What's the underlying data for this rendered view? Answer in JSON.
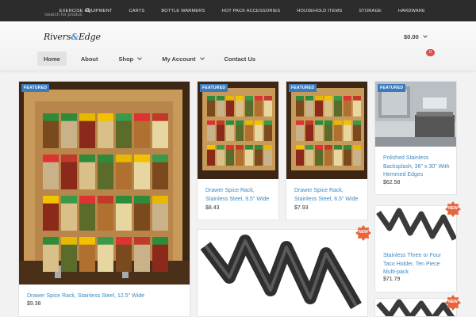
{
  "topbar": {
    "search_placeholder": "Search for product",
    "nav": [
      "EXERCISE EQUIPMENT",
      "CARTS",
      "BOTTLE WARMERS",
      "HOT PACK ACCESSORIES",
      "HOUSEHOLD ITEMS",
      "STORAGE",
      "HARDWARE"
    ]
  },
  "header": {
    "logo_left": "Rivers",
    "logo_amp": "&",
    "logo_right": "Edge",
    "nav": [
      {
        "label": "Home"
      },
      {
        "label": "About"
      },
      {
        "label": "Shop"
      },
      {
        "label": "My Account"
      },
      {
        "label": "Contact Us"
      }
    ],
    "cart_total": "$0.00",
    "cart_count": "0"
  },
  "badges": {
    "featured": "FEATURED",
    "new": "NEW"
  },
  "products": [
    {
      "title": "Drawer Spice Rack, Stainless Steel, 12.5\" Wide",
      "price": "$9.38"
    },
    {
      "title": "Drawer Spice Rack, Stainless Steel, 9.5\" Wide",
      "price": "$8.43"
    },
    {
      "title": "Drawer Spice Rack, Stainless Steel, 6.5\" Wide",
      "price": "$7.93"
    },
    {
      "title": "Polished Stainless Backsplash, 36\" x 30\" With Hemmed Edges",
      "price": "$62.58"
    },
    {
      "title": "Stainless Three or Four Taco Holder, Ten Piece Multi-pack",
      "price": "$71.79"
    }
  ],
  "colors": {
    "accent": "#3a7bbf",
    "link": "#3b8ac4",
    "new_badge": "#e8643c",
    "topbar": "#2c2c2c"
  }
}
